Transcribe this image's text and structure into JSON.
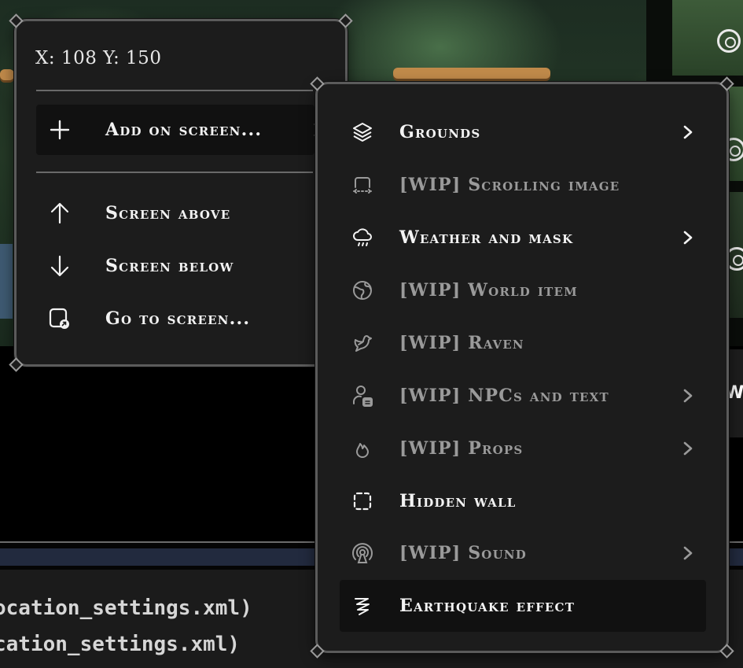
{
  "context_menu": {
    "coords_text": "X: 108 Y: 150",
    "items": [
      {
        "label": "Add on screen...",
        "icon": "plus-icon",
        "has_submenu": true
      },
      {
        "label": "Screen above",
        "icon": "arrow-up-icon",
        "has_submenu": false
      },
      {
        "label": "Screen below",
        "icon": "arrow-down-icon",
        "has_submenu": false
      },
      {
        "label": "Go to screen...",
        "icon": "go-to-screen-icon",
        "has_submenu": false
      }
    ]
  },
  "submenu": {
    "items": [
      {
        "label": "Grounds",
        "icon": "layers-icon",
        "has_submenu": true,
        "disabled": false
      },
      {
        "label": "[WIP] Scrolling image",
        "icon": "scrolling-image-icon",
        "has_submenu": false,
        "disabled": true
      },
      {
        "label": "Weather and mask",
        "icon": "cloud-rain-icon",
        "has_submenu": true,
        "disabled": false
      },
      {
        "label": "[WIP] World item",
        "icon": "globe-icon",
        "has_submenu": false,
        "disabled": true
      },
      {
        "label": "[WIP] Raven",
        "icon": "bird-icon",
        "has_submenu": false,
        "disabled": true
      },
      {
        "label": "[WIP] NPCs and text",
        "icon": "user-message-icon",
        "has_submenu": true,
        "disabled": true
      },
      {
        "label": "[WIP] Props",
        "icon": "flame-icon",
        "has_submenu": true,
        "disabled": true
      },
      {
        "label": "Hidden wall",
        "icon": "dashed-square-icon",
        "has_submenu": false,
        "disabled": false
      },
      {
        "label": "[WIP] Sound",
        "icon": "broadcast-icon",
        "has_submenu": true,
        "disabled": true
      },
      {
        "label": "Earthquake effect",
        "icon": "wave-icon",
        "has_submenu": false,
        "disabled": false
      }
    ]
  },
  "console": {
    "lines": [
      "ocation_settings.xml)",
      "cation_settings.xml)"
    ]
  },
  "colors": {
    "menu_bg": "#1c1c1c",
    "menu_border": "#5b5b5b",
    "text_enabled": "#f3f3f3",
    "text_disabled": "#9a9a9a",
    "highlight_bg": "#111111"
  }
}
